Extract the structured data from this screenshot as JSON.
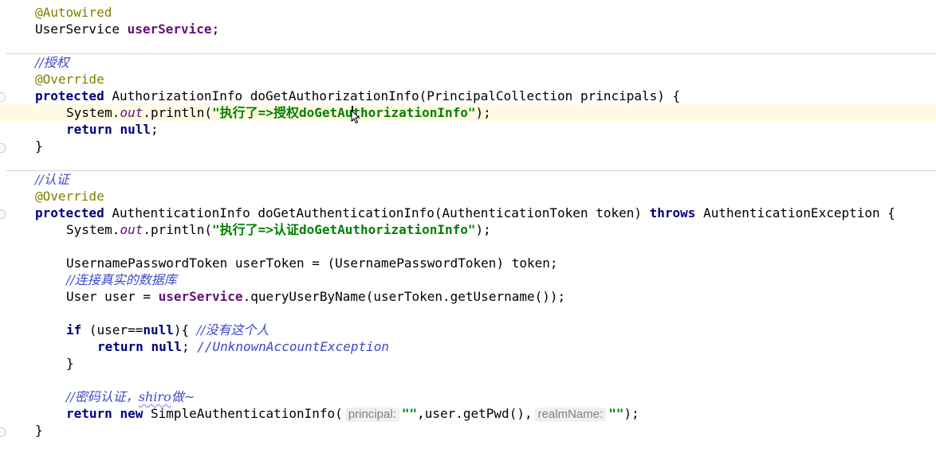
{
  "code": {
    "autowired": "@Autowired",
    "field_type": "UserService ",
    "field_name": "userService",
    "semicolon": ";",
    "comment_authz": "//授权",
    "override": "@Override",
    "kw_protected": "protected",
    "authz_sig": " AuthorizationInfo doGetAuthorizationInfo(PrincipalCollection principals) {",
    "system": "System.",
    "out": "out",
    "println_open": ".println(",
    "str_authz": "\"执行了=>授权doGetAuthorizationInfo\"",
    "println_close": ");",
    "kw_return": "return",
    "kw_null": "null",
    "close_brace": "}",
    "comment_authn": "//认证",
    "authn_sig_a": " AuthenticationInfo doGetAuthenticationInfo(AuthenticationToken token) ",
    "kw_throws": "throws",
    "authn_sig_b": " AuthenticationException {",
    "str_authn": "\"执行了=>认证doGetAuthorizationInfo\"",
    "token_line": "UsernamePasswordToken userToken = (UsernamePasswordToken) token;",
    "comment_db": "//连接真实的数据库",
    "user_decl": "User user = ",
    "query_call": ".queryUserByName(userToken.getUsername());",
    "kw_if": "if",
    "if_cond_a": " (user==",
    "if_cond_b": "){ ",
    "comment_no_user": "//没有这个人",
    "return_null_tail": "; ",
    "comment_unknown": "//UnknownAccountException",
    "comment_pwd_a": "//密码认证，",
    "comment_pwd_shiro": "shiro",
    "comment_pwd_b": "做~",
    "kw_new": "new",
    "simple_info": " SimpleAuthenticationInfo(",
    "hint_principal": "principal:",
    "empty_str": "\"\"",
    "get_pwd": ",user.getPwd(),",
    "hint_realm": "realmName:"
  }
}
